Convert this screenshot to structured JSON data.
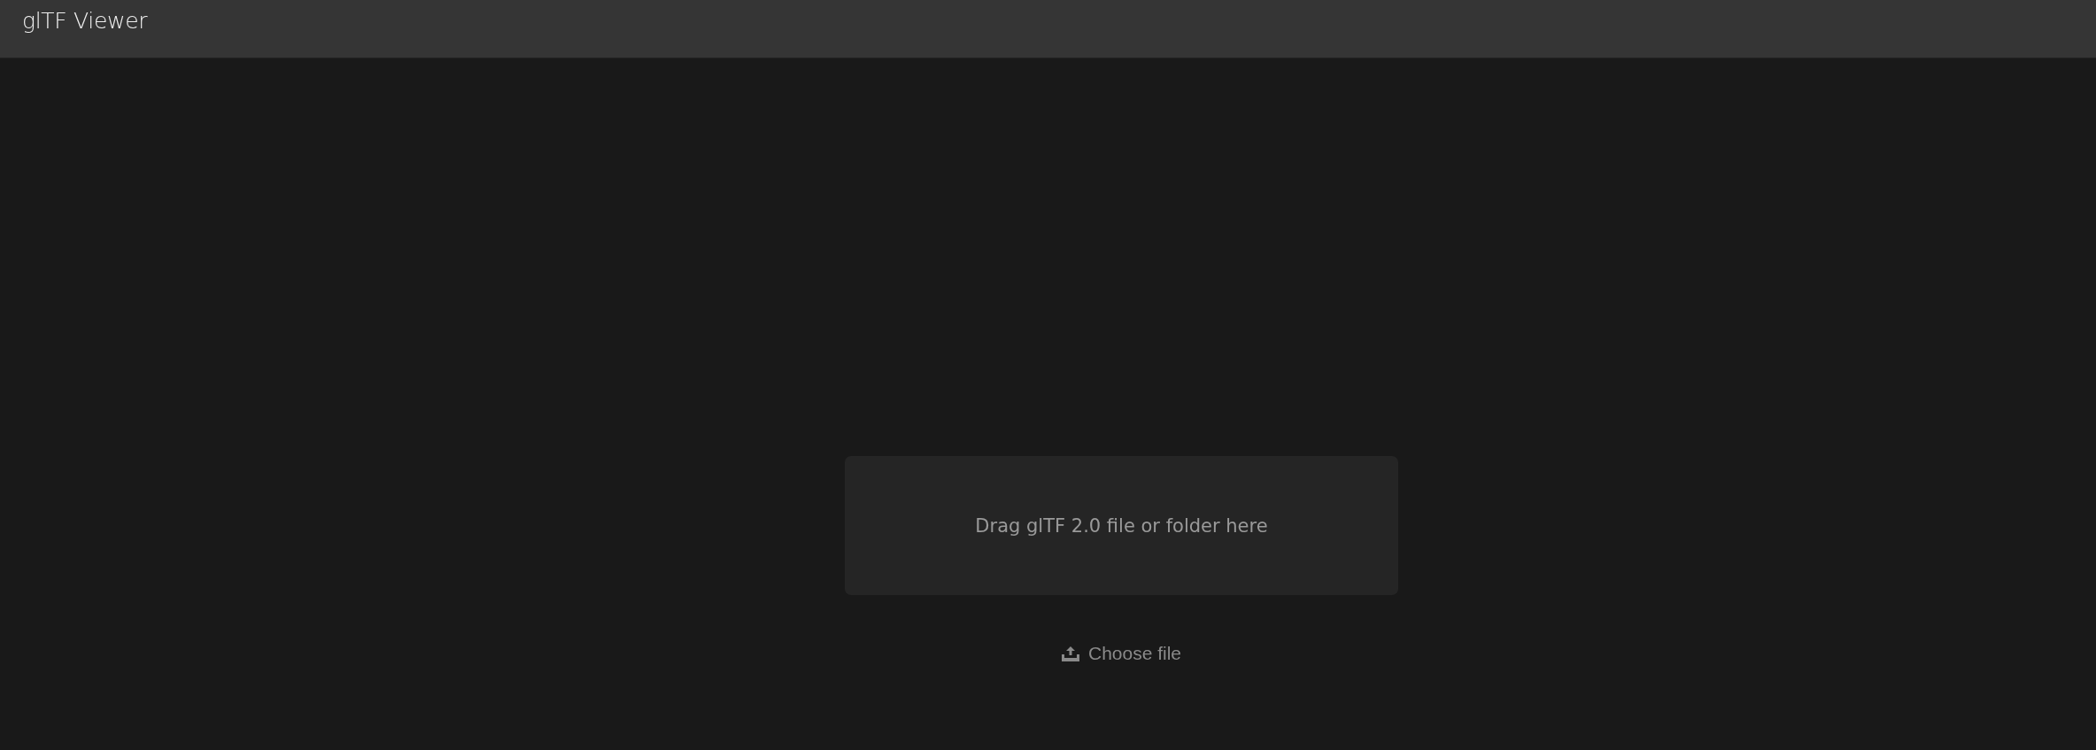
{
  "header": {
    "title": "glTF Viewer"
  },
  "dropzone": {
    "prompt": "Drag glTF 2.0 file or folder here"
  },
  "upload": {
    "label": "Choose file"
  }
}
